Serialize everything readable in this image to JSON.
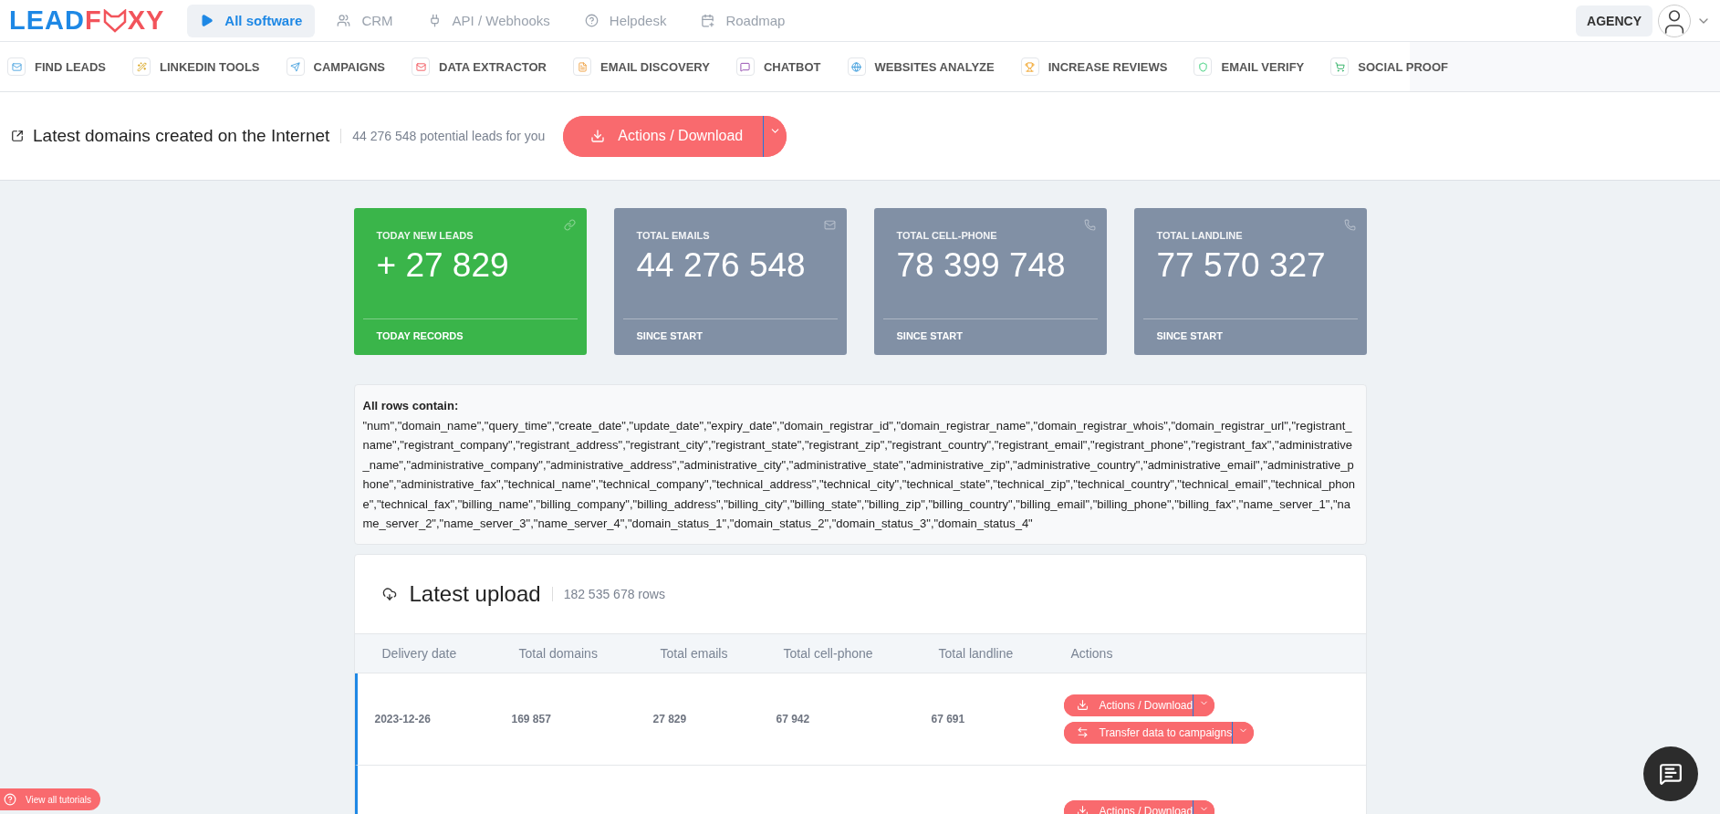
{
  "logo": {
    "parts": [
      {
        "text": "LEAD",
        "kind": "main"
      },
      {
        "text": "F",
        "kind": "accent"
      },
      {
        "text": "XY",
        "kind": "accent"
      }
    ]
  },
  "top_nav": [
    {
      "label": "All software",
      "selected": true
    },
    {
      "label": "CRM",
      "selected": false
    },
    {
      "label": "API / Webhooks",
      "selected": false
    },
    {
      "label": "Helpdesk",
      "selected": false
    },
    {
      "label": "Roadmap",
      "selected": false
    }
  ],
  "account": {
    "plan": "AGENCY"
  },
  "tools_nav": [
    "FIND LEADS",
    "LINKEDIN TOOLS",
    "CAMPAIGNS",
    "DATA EXTRACTOR",
    "EMAIL DISCOVERY",
    "CHATBOT",
    "WEBSITES ANALYZE",
    "INCREASE REVIEWS",
    "EMAIL VERIFY",
    "SOCIAL PROOF"
  ],
  "page_header": {
    "title": "Latest domains created on the Internet",
    "subtitle": "44 276 548 potential leads for you",
    "action": "Actions / Download"
  },
  "stats": [
    {
      "kind": "highlight",
      "label": "TODAY NEW LEADS",
      "value": "+ 27 829",
      "footer": "TODAY RECORDS"
    },
    {
      "kind": "neutral",
      "label": "TOTAL EMAILS",
      "value": "44 276 548",
      "footer": "SINCE START"
    },
    {
      "kind": "neutral",
      "label": "TOTAL CELL-PHONE",
      "value": "78 399 748",
      "footer": "SINCE START"
    },
    {
      "kind": "neutral",
      "label": "TOTAL LANDLINE",
      "value": "77 570 327",
      "footer": "SINCE START"
    }
  ],
  "fields_info": {
    "title": "All rows contain:",
    "text": "\"num\",\"domain_name\",\"query_time\",\"create_date\",\"update_date\",\"expiry_date\",\"domain_registrar_id\",\"domain_registrar_name\",\"domain_registrar_whois\",\"domain_registrar_url\",\"registrant_name\",\"registrant_company\",\"registrant_address\",\"registrant_city\",\"registrant_state\",\"registrant_zip\",\"registrant_country\",\"registrant_email\",\"registrant_phone\",\"registrant_fax\",\"administrative_name\",\"administrative_company\",\"administrative_address\",\"administrative_city\",\"administrative_state\",\"administrative_zip\",\"administrative_country\",\"administrative_email\",\"administrative_phone\",\"administrative_fax\",\"technical_name\",\"technical_company\",\"technical_address\",\"technical_city\",\"technical_state\",\"technical_zip\",\"technical_country\",\"technical_email\",\"technical_phone\",\"technical_fax\",\"billing_name\",\"billing_company\",\"billing_address\",\"billing_city\",\"billing_state\",\"billing_zip\",\"billing_country\",\"billing_email\",\"billing_phone\",\"billing_fax\",\"name_server_1\",\"name_server_2\",\"name_server_3\",\"name_server_4\",\"domain_status_1\",\"domain_status_2\",\"domain_status_3\",\"domain_status_4\""
  },
  "uploads": {
    "title": "Latest upload",
    "count": "182 535 678 rows",
    "columns": [
      "Delivery date",
      "Total domains",
      "Total emails",
      "Total cell-phone",
      "Total landline",
      "Actions"
    ],
    "rows": [
      {
        "cells": [
          "2023-12-26",
          "169 857",
          "27 829",
          "67 942",
          "67 691"
        ],
        "actions": [
          {
            "kind": "download",
            "label": "Actions / Download"
          },
          {
            "kind": "transfer",
            "label": "Transfer data to campaigns"
          }
        ]
      },
      {
        "cells": [],
        "actions": [
          {
            "kind": "download",
            "label": "Actions / Download"
          }
        ]
      }
    ]
  },
  "tutorials_button": "View all tutorials"
}
